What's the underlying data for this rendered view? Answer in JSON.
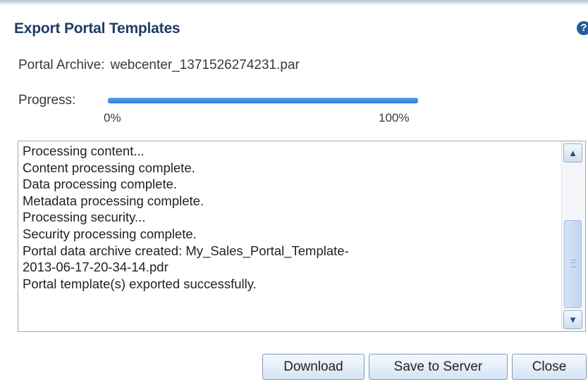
{
  "dialog": {
    "title": "Export Portal Templates",
    "help_icon": "question-circle-icon",
    "help_glyph": "?"
  },
  "archive": {
    "label": "Portal Archive:",
    "value": "webcenter_1371526274231.par"
  },
  "progress": {
    "label": "Progress:",
    "percent": 100,
    "min_label": "0%",
    "max_label": "100%",
    "color": "#3d8ae8"
  },
  "log": {
    "lines": [
      "Processing content...",
      "Content processing complete.",
      "Data processing complete.",
      "Metadata processing complete.",
      "Processing security...",
      "Security processing complete.",
      "Portal data archive created: My_Sales_Portal_Template-",
      "2013-06-17-20-34-14.pdr",
      "Portal template(s) exported successfully."
    ],
    "scroll_up_icon": "chevron-up-icon",
    "scroll_down_icon": "chevron-down-icon",
    "scroll_up_glyph": "▲",
    "scroll_down_glyph": "▼"
  },
  "buttons": {
    "download": "Download",
    "save_to_server": "Save to Server",
    "close": "Close"
  },
  "colors": {
    "title": "#1f3d66",
    "help_icon": "#2a5c9c",
    "button_border": "#7f9db9"
  }
}
